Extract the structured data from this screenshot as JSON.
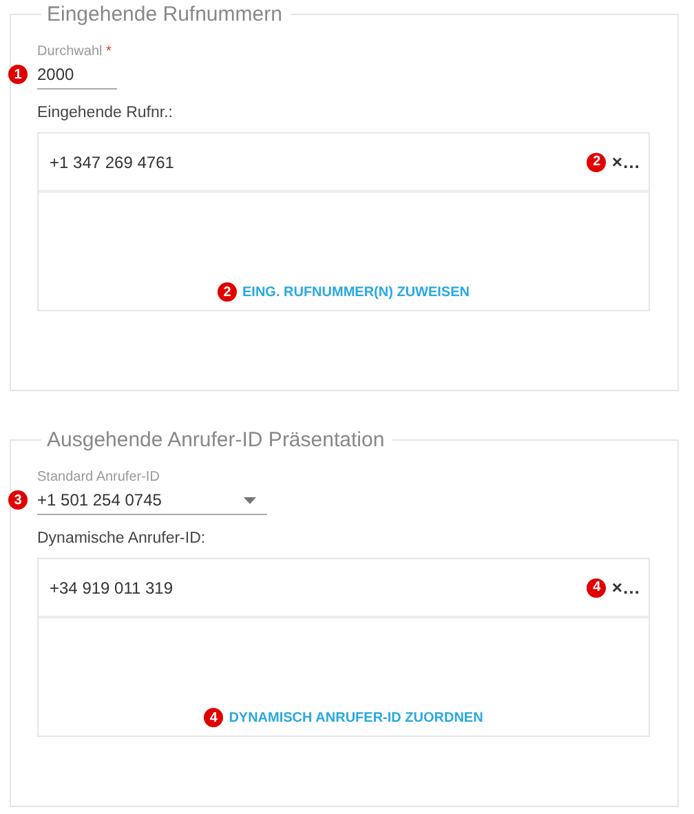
{
  "sections": [
    {
      "title": "Eingehende Rufnummern",
      "field": {
        "kind": "text",
        "label": "Durchwahl",
        "required_mark": "*",
        "value": "2000",
        "badge": "1"
      },
      "list_label": "Eingehende Rufnr.:",
      "items": [
        {
          "number": "+1 347 269 4761",
          "badge": "2",
          "remove": "×…"
        }
      ],
      "action": {
        "label": "EING. RUFNUMMER(N) ZUWEISEN",
        "badge": "2"
      }
    },
    {
      "title": "Ausgehende Anrufer-ID Präsentation",
      "field": {
        "kind": "select",
        "label": "Standard Anrufer-ID",
        "value": "+1 501 254 0745",
        "badge": "3"
      },
      "list_label": "Dynamische Anrufer-ID:",
      "items": [
        {
          "number": "+34 919 011 319",
          "badge": "4",
          "remove": "×…"
        }
      ],
      "action": {
        "label": "DYNAMISCH ANRUFER-ID ZUORDNEN",
        "badge": "4"
      }
    }
  ]
}
